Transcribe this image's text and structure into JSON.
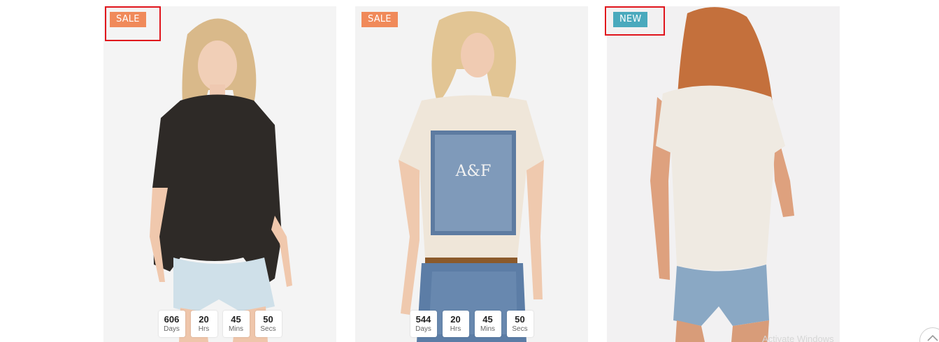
{
  "products": [
    {
      "badge": "SALE",
      "badge_color": "#f08a5a",
      "countdown": [
        {
          "value": "606",
          "unit": "Days"
        },
        {
          "value": "20",
          "unit": "Hrs"
        },
        {
          "value": "45",
          "unit": "Mins"
        },
        {
          "value": "50",
          "unit": "Secs"
        }
      ]
    },
    {
      "badge": "SALE",
      "badge_color": "#f08a5a",
      "countdown": [
        {
          "value": "544",
          "unit": "Days"
        },
        {
          "value": "20",
          "unit": "Hrs"
        },
        {
          "value": "45",
          "unit": "Mins"
        },
        {
          "value": "50",
          "unit": "Secs"
        }
      ]
    },
    {
      "badge": "NEW",
      "badge_color": "#4aa9bd",
      "countdown": []
    }
  ],
  "watermark": "Activate Windows",
  "colors": {
    "highlight": "#e0141c",
    "sale": "#f08a5a",
    "new": "#4aa9bd"
  },
  "icons": {
    "scroll_top": "chevron-up-icon"
  }
}
